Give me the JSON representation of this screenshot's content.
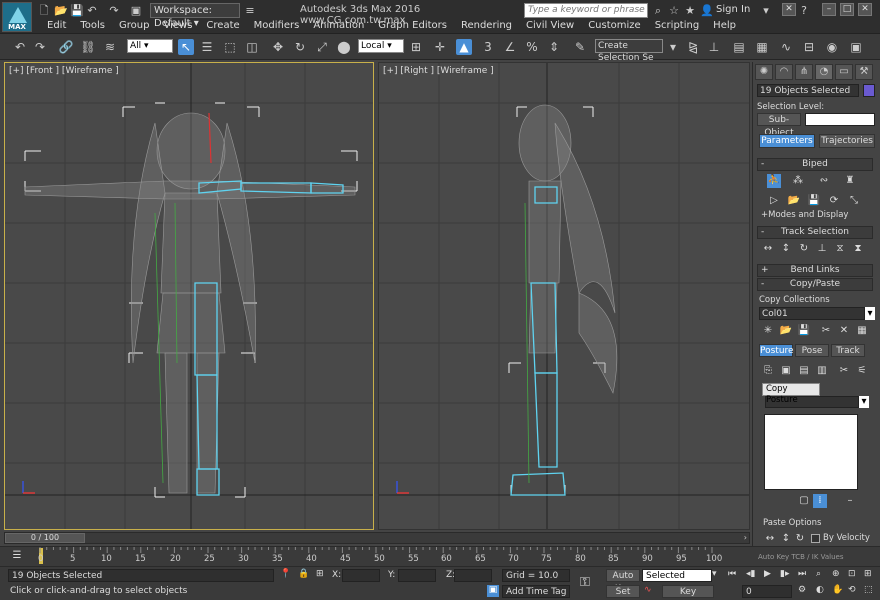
{
  "titlebar": {
    "logo_text": "MAX",
    "workspace": "Workspace: Default",
    "app_title": "Autodesk 3ds Max 2016    www.CG.com.tw.max",
    "search_placeholder": "Type a keyword or phrase",
    "sign_in": "Sign In"
  },
  "menu": [
    "Edit",
    "Tools",
    "Group",
    "Views",
    "Create",
    "Modifiers",
    "Animation",
    "Graph Editors",
    "Rendering",
    "Civil View",
    "Customize",
    "Scripting",
    "Help"
  ],
  "toolbar": {
    "selection_filter": "All",
    "reference_coord": "Local",
    "named_selection": "Create Selection Se"
  },
  "viewports": {
    "front_label": "[+] [Front ] [Wireframe ]",
    "right_label": "[+] [Right ] [Wireframe ]"
  },
  "command_panel": {
    "selection_name": "19 Objects Selected",
    "selection_level_label": "Selection Level:",
    "sub_object": "Sub-Object",
    "parameters_tab": "Parameters",
    "trajectories_tab": "Trajectories",
    "biped_rollout": "Biped",
    "modes_display": "+Modes and Display",
    "track_selection_rollout": "Track Selection",
    "bend_links_rollout": "Bend Links",
    "copy_paste_rollout": "Copy/Paste",
    "copy_collections_label": "Copy Collections",
    "collection_name": "Col01",
    "posture_tab": "Posture",
    "pose_tab": "Pose",
    "track_tab": "Track",
    "tooltip": "Copy Posture",
    "paste_options_label": "Paste Options",
    "by_velocity": "By Velocity",
    "auto_key_truncated": "Auto Key TCB / IK Values"
  },
  "timeline": {
    "frame_counter": "0 / 100",
    "ticks": [
      "0",
      "5",
      "10",
      "15",
      "20",
      "25",
      "30",
      "35",
      "40",
      "45",
      "50",
      "55",
      "60",
      "65",
      "70",
      "75",
      "80",
      "85",
      "90",
      "95",
      "100"
    ]
  },
  "status": {
    "selected_count": "19 Objects Selected",
    "prompt": "Click or click-and-drag to select objects",
    "x_label": "X:",
    "y_label": "Y:",
    "z_label": "Z:",
    "grid": "Grid = 10.0",
    "add_time_tag": "Add Time Tag",
    "auto_key": "Auto Key",
    "set_key": "Set Key",
    "key_mode": "Selected",
    "key_filters": "Key Filters...",
    "current_frame": "0"
  },
  "colors": {
    "viewport_bg": "#494949",
    "active_border": "#c8b04a",
    "accent": "#4a8fd6",
    "selection_highlight": "#5fd3f0"
  }
}
